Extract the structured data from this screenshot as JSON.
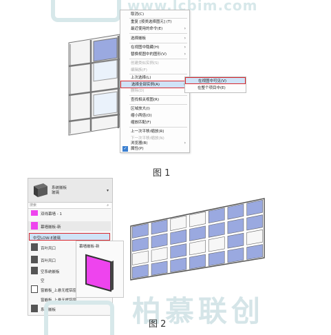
{
  "watermark": {
    "url": "www.lcbim.com",
    "brand": "柏慕联创"
  },
  "menu": {
    "items": [
      {
        "label": "取消(C)"
      },
      {
        "label": "重复 [按类选择图元] (T)"
      },
      {
        "label": "最近使用的命令(E)",
        "arrow": "›"
      },
      {
        "label": "选择嵌板",
        "arrow": "›"
      },
      {
        "label": "在视图中隐藏(H)",
        "arrow": "›"
      },
      {
        "label": "替换视图中的图形(V)",
        "arrow": "›"
      },
      {
        "label": "创建类似实例(S)"
      },
      {
        "label": "编辑族(F)"
      },
      {
        "label": "上次选择(L)"
      },
      {
        "label": "选择全部实例(A)",
        "arrow": "›"
      },
      {
        "label": "删除(D)"
      },
      {
        "label": "查找相关视图(R)"
      },
      {
        "label": "区域放大(I)"
      },
      {
        "label": "缩小两倍(O)"
      },
      {
        "label": "缩放匹配(F)"
      },
      {
        "label": "上一次平移/缩放(R)"
      },
      {
        "label": "下一次平移/缩放(N)"
      },
      {
        "label": "浏览器(B)",
        "arrow": "›"
      },
      {
        "label": "属性(P)"
      }
    ],
    "submenu": [
      "在视图中可见(V)",
      "在整个项目中(E)"
    ]
  },
  "captions": {
    "fig1": "图 1",
    "fig2": "图 2"
  },
  "type_selector": {
    "family": "系统嵌板",
    "type": "玻璃"
  },
  "dropdown": {
    "search_placeholder": "搜索",
    "rows": [
      {
        "label": "双线幕墙 - 1"
      },
      {
        "label": "幕墙嵌板-新"
      },
      {
        "label": "中空LOW-E玻璃"
      },
      {
        "label": "百叶风口"
      },
      {
        "label": "百叶风口"
      },
      {
        "label": "空系统嵌板"
      },
      {
        "label": "空"
      },
      {
        "label": "窗嵌板_上悬无框铝窗"
      },
      {
        "label": "窗嵌板_上悬无框铝窗"
      },
      {
        "label": "系统嵌板"
      }
    ],
    "preview_title": "幕墙嵌板-新"
  },
  "colors": {
    "highlight_red": "#d9272e",
    "menu_hover": "#cfe3f7",
    "glass": "#9aa9e0",
    "magenta": "#ee44ee"
  }
}
